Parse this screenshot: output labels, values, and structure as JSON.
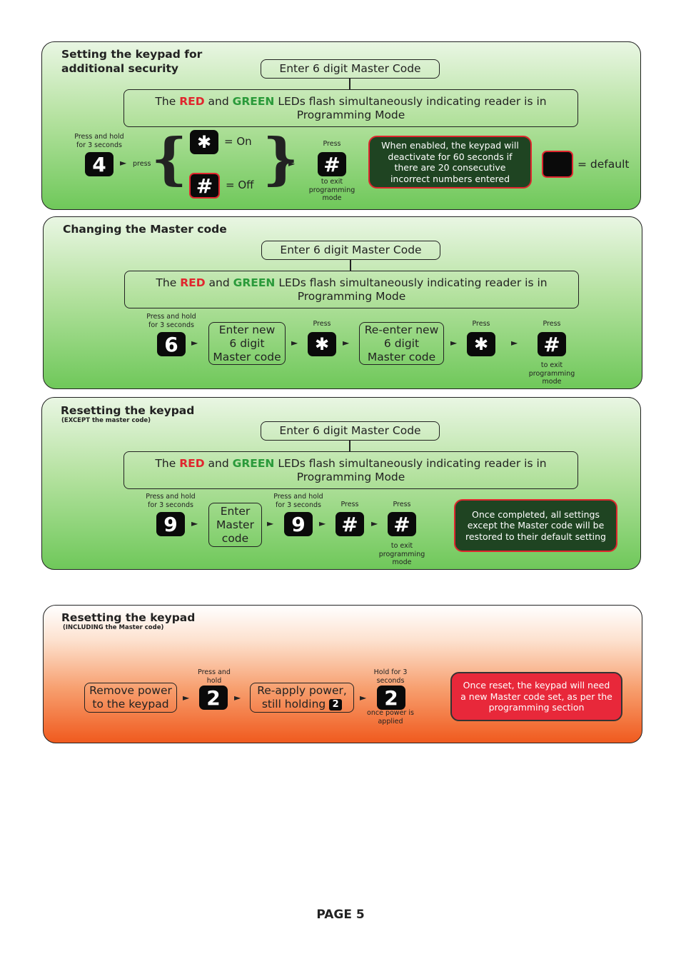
{
  "common": {
    "master_code_box": "Enter 6 digit Master Code",
    "led_line1_pre": "The ",
    "led_red": "RED",
    "led_and": " and ",
    "led_green": "GREEN",
    "led_line1_post": " LEDs flash simultaneously indicating reader is in",
    "led_line2": "Programming Mode"
  },
  "section1": {
    "title_line1": "Setting the keypad for",
    "title_line2": "additional security",
    "hold_caption": "Press and hold\nfor 3 seconds",
    "key_start": "4",
    "press_label": "press",
    "key_on": "✱",
    "on_label": "= On",
    "key_off": "#",
    "off_label": "= Off",
    "press_caption": "Press",
    "key_exit": "#",
    "exit_caption": "to exit\nprogramming\nmode",
    "note": "When enabled, the keypad will deactivate for 60 seconds if there are 20 consecutive incorrect numbers entered",
    "default_label": "= default"
  },
  "section2": {
    "title": "Changing the Master code",
    "hold_caption": "Press and hold\nfor 3 seconds",
    "key_start": "6",
    "step1": "Enter new\n6 digit\nMaster code",
    "press1": "Press",
    "key_star1": "✱",
    "step2": "Re-enter new\n6 digit\nMaster code",
    "press2": "Press",
    "key_star2": "✱",
    "press3": "Press",
    "key_exit": "#",
    "exit_caption": "to exit\nprogramming\nmode"
  },
  "section3": {
    "title": "Resetting the keypad",
    "subtitle": "(EXCEPT the master code)",
    "hold_caption1": "Press and hold\nfor 3 seconds",
    "key_start": "9",
    "step1": "Enter\nMaster\ncode",
    "hold_caption2": "Press and hold\nfor 3 seconds",
    "key_nine2": "9",
    "press1": "Press",
    "key_hash1": "#",
    "press2": "Press",
    "key_hash2": "#",
    "exit_caption": "to exit\nprogramming\nmode",
    "note": "Once completed, all settings except the Master code will be restored to their default setting"
  },
  "section4": {
    "title": "Resetting the keypad",
    "subtitle": "(INCLUDING the Master code)",
    "step1": "Remove power\nto the keypad",
    "hold_caption": "Press and\nhold",
    "key_two": "2",
    "step2": "Re-apply power,\nstill holding",
    "inline_key": "2",
    "hold3_caption": "Hold for 3\nseconds",
    "key_two2": "2",
    "after_caption": "once power is\napplied",
    "note": "Once reset, the keypad will need a new Master code set, as per the programming section"
  },
  "footer": {
    "page_label": "PAGE 5"
  },
  "colors": {
    "led_red": "#e0262e",
    "led_green": "#2a9a3a",
    "note_dark": "#1f4422",
    "note_red": "#e8283a"
  }
}
